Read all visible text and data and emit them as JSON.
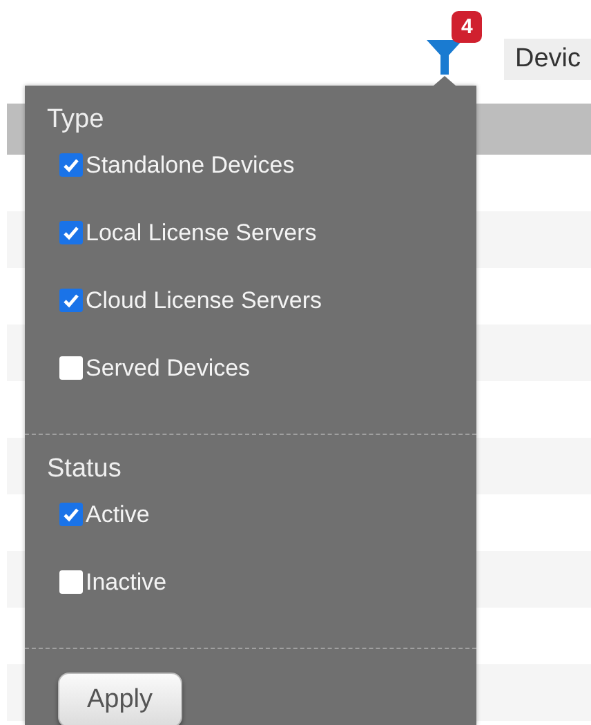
{
  "toolbar": {
    "filter_badge": "4",
    "device_field": "Devic"
  },
  "filter_panel": {
    "sections": [
      {
        "title": "Type",
        "options": [
          {
            "label": "Standalone Devices",
            "checked": true
          },
          {
            "label": "Local License Servers",
            "checked": true
          },
          {
            "label": "Cloud License Servers",
            "checked": true
          },
          {
            "label": "Served Devices",
            "checked": false
          }
        ]
      },
      {
        "title": "Status",
        "options": [
          {
            "label": "Active",
            "checked": true
          },
          {
            "label": "Inactive",
            "checked": false
          }
        ]
      }
    ],
    "apply_button": "Apply"
  }
}
